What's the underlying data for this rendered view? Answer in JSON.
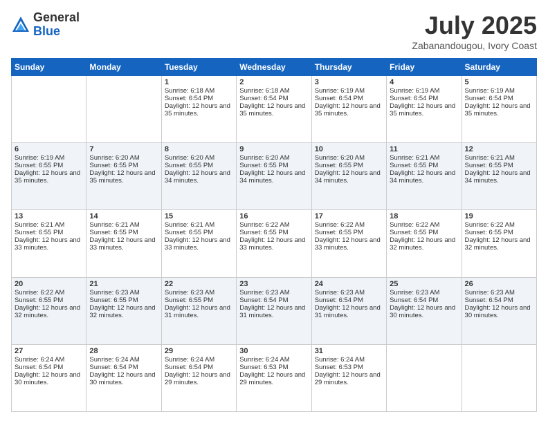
{
  "logo": {
    "general": "General",
    "blue": "Blue"
  },
  "title": {
    "month": "July 2025",
    "location": "Zabanandougou, Ivory Coast"
  },
  "days": [
    "Sunday",
    "Monday",
    "Tuesday",
    "Wednesday",
    "Thursday",
    "Friday",
    "Saturday"
  ],
  "weeks": [
    [
      {
        "day": "",
        "sunrise": "",
        "sunset": "",
        "daylight": ""
      },
      {
        "day": "",
        "sunrise": "",
        "sunset": "",
        "daylight": ""
      },
      {
        "day": "1",
        "sunrise": "Sunrise: 6:18 AM",
        "sunset": "Sunset: 6:54 PM",
        "daylight": "Daylight: 12 hours and 35 minutes."
      },
      {
        "day": "2",
        "sunrise": "Sunrise: 6:18 AM",
        "sunset": "Sunset: 6:54 PM",
        "daylight": "Daylight: 12 hours and 35 minutes."
      },
      {
        "day": "3",
        "sunrise": "Sunrise: 6:19 AM",
        "sunset": "Sunset: 6:54 PM",
        "daylight": "Daylight: 12 hours and 35 minutes."
      },
      {
        "day": "4",
        "sunrise": "Sunrise: 6:19 AM",
        "sunset": "Sunset: 6:54 PM",
        "daylight": "Daylight: 12 hours and 35 minutes."
      },
      {
        "day": "5",
        "sunrise": "Sunrise: 6:19 AM",
        "sunset": "Sunset: 6:54 PM",
        "daylight": "Daylight: 12 hours and 35 minutes."
      }
    ],
    [
      {
        "day": "6",
        "sunrise": "Sunrise: 6:19 AM",
        "sunset": "Sunset: 6:55 PM",
        "daylight": "Daylight: 12 hours and 35 minutes."
      },
      {
        "day": "7",
        "sunrise": "Sunrise: 6:20 AM",
        "sunset": "Sunset: 6:55 PM",
        "daylight": "Daylight: 12 hours and 35 minutes."
      },
      {
        "day": "8",
        "sunrise": "Sunrise: 6:20 AM",
        "sunset": "Sunset: 6:55 PM",
        "daylight": "Daylight: 12 hours and 34 minutes."
      },
      {
        "day": "9",
        "sunrise": "Sunrise: 6:20 AM",
        "sunset": "Sunset: 6:55 PM",
        "daylight": "Daylight: 12 hours and 34 minutes."
      },
      {
        "day": "10",
        "sunrise": "Sunrise: 6:20 AM",
        "sunset": "Sunset: 6:55 PM",
        "daylight": "Daylight: 12 hours and 34 minutes."
      },
      {
        "day": "11",
        "sunrise": "Sunrise: 6:21 AM",
        "sunset": "Sunset: 6:55 PM",
        "daylight": "Daylight: 12 hours and 34 minutes."
      },
      {
        "day": "12",
        "sunrise": "Sunrise: 6:21 AM",
        "sunset": "Sunset: 6:55 PM",
        "daylight": "Daylight: 12 hours and 34 minutes."
      }
    ],
    [
      {
        "day": "13",
        "sunrise": "Sunrise: 6:21 AM",
        "sunset": "Sunset: 6:55 PM",
        "daylight": "Daylight: 12 hours and 33 minutes."
      },
      {
        "day": "14",
        "sunrise": "Sunrise: 6:21 AM",
        "sunset": "Sunset: 6:55 PM",
        "daylight": "Daylight: 12 hours and 33 minutes."
      },
      {
        "day": "15",
        "sunrise": "Sunrise: 6:21 AM",
        "sunset": "Sunset: 6:55 PM",
        "daylight": "Daylight: 12 hours and 33 minutes."
      },
      {
        "day": "16",
        "sunrise": "Sunrise: 6:22 AM",
        "sunset": "Sunset: 6:55 PM",
        "daylight": "Daylight: 12 hours and 33 minutes."
      },
      {
        "day": "17",
        "sunrise": "Sunrise: 6:22 AM",
        "sunset": "Sunset: 6:55 PM",
        "daylight": "Daylight: 12 hours and 33 minutes."
      },
      {
        "day": "18",
        "sunrise": "Sunrise: 6:22 AM",
        "sunset": "Sunset: 6:55 PM",
        "daylight": "Daylight: 12 hours and 32 minutes."
      },
      {
        "day": "19",
        "sunrise": "Sunrise: 6:22 AM",
        "sunset": "Sunset: 6:55 PM",
        "daylight": "Daylight: 12 hours and 32 minutes."
      }
    ],
    [
      {
        "day": "20",
        "sunrise": "Sunrise: 6:22 AM",
        "sunset": "Sunset: 6:55 PM",
        "daylight": "Daylight: 12 hours and 32 minutes."
      },
      {
        "day": "21",
        "sunrise": "Sunrise: 6:23 AM",
        "sunset": "Sunset: 6:55 PM",
        "daylight": "Daylight: 12 hours and 32 minutes."
      },
      {
        "day": "22",
        "sunrise": "Sunrise: 6:23 AM",
        "sunset": "Sunset: 6:55 PM",
        "daylight": "Daylight: 12 hours and 31 minutes."
      },
      {
        "day": "23",
        "sunrise": "Sunrise: 6:23 AM",
        "sunset": "Sunset: 6:54 PM",
        "daylight": "Daylight: 12 hours and 31 minutes."
      },
      {
        "day": "24",
        "sunrise": "Sunrise: 6:23 AM",
        "sunset": "Sunset: 6:54 PM",
        "daylight": "Daylight: 12 hours and 31 minutes."
      },
      {
        "day": "25",
        "sunrise": "Sunrise: 6:23 AM",
        "sunset": "Sunset: 6:54 PM",
        "daylight": "Daylight: 12 hours and 30 minutes."
      },
      {
        "day": "26",
        "sunrise": "Sunrise: 6:23 AM",
        "sunset": "Sunset: 6:54 PM",
        "daylight": "Daylight: 12 hours and 30 minutes."
      }
    ],
    [
      {
        "day": "27",
        "sunrise": "Sunrise: 6:24 AM",
        "sunset": "Sunset: 6:54 PM",
        "daylight": "Daylight: 12 hours and 30 minutes."
      },
      {
        "day": "28",
        "sunrise": "Sunrise: 6:24 AM",
        "sunset": "Sunset: 6:54 PM",
        "daylight": "Daylight: 12 hours and 30 minutes."
      },
      {
        "day": "29",
        "sunrise": "Sunrise: 6:24 AM",
        "sunset": "Sunset: 6:54 PM",
        "daylight": "Daylight: 12 hours and 29 minutes."
      },
      {
        "day": "30",
        "sunrise": "Sunrise: 6:24 AM",
        "sunset": "Sunset: 6:53 PM",
        "daylight": "Daylight: 12 hours and 29 minutes."
      },
      {
        "day": "31",
        "sunrise": "Sunrise: 6:24 AM",
        "sunset": "Sunset: 6:53 PM",
        "daylight": "Daylight: 12 hours and 29 minutes."
      },
      {
        "day": "",
        "sunrise": "",
        "sunset": "",
        "daylight": ""
      },
      {
        "day": "",
        "sunrise": "",
        "sunset": "",
        "daylight": ""
      }
    ]
  ]
}
